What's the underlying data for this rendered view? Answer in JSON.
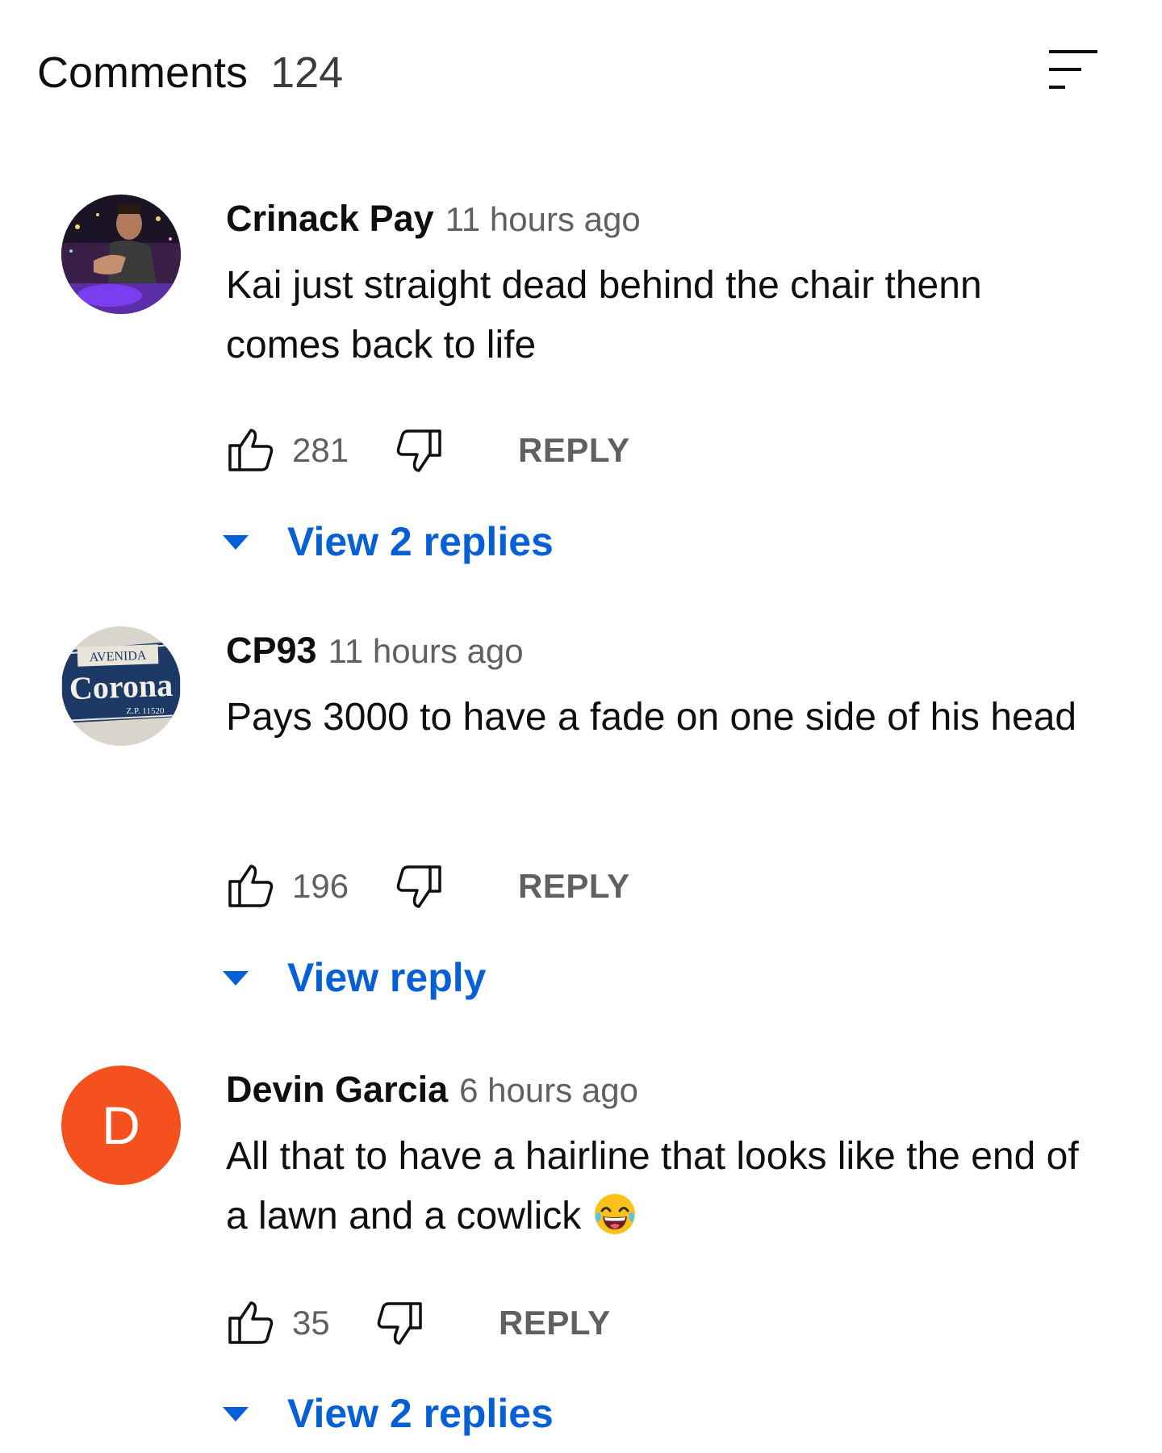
{
  "header": {
    "title": "Comments",
    "count": "124",
    "sort_icon": "sort-icon"
  },
  "comments": [
    {
      "author": "Crinack Pay",
      "time": "11 hours ago",
      "text": "Kai just straight dead behind the chair thenn comes back to life",
      "likes": "281",
      "reply_label": "REPLY",
      "view_replies": "View 2 replies",
      "avatar": "photo"
    },
    {
      "author": "CP93",
      "time": "11 hours ago",
      "text": "Pays 3000 to have a fade on one side of his head",
      "likes": "196",
      "reply_label": "REPLY",
      "view_replies": "View reply",
      "avatar": "corona-sign",
      "avatar_text": {
        "top": "AVENIDA",
        "main": "Corona",
        "bottom": "Z.P. 11520"
      }
    },
    {
      "author": "Devin Garcia",
      "time": "6 hours ago",
      "text": "All that to have a hairline that looks like the end of a lawn and a cowlick",
      "emoji": "laughing-tears-emoji",
      "likes": "35",
      "reply_label": "REPLY",
      "view_replies": "View 2 replies",
      "avatar": "letter",
      "avatar_letter": "D",
      "avatar_color": "#f4511e"
    }
  ],
  "colors": {
    "link": "#065fd4",
    "secondary": "#606060"
  }
}
